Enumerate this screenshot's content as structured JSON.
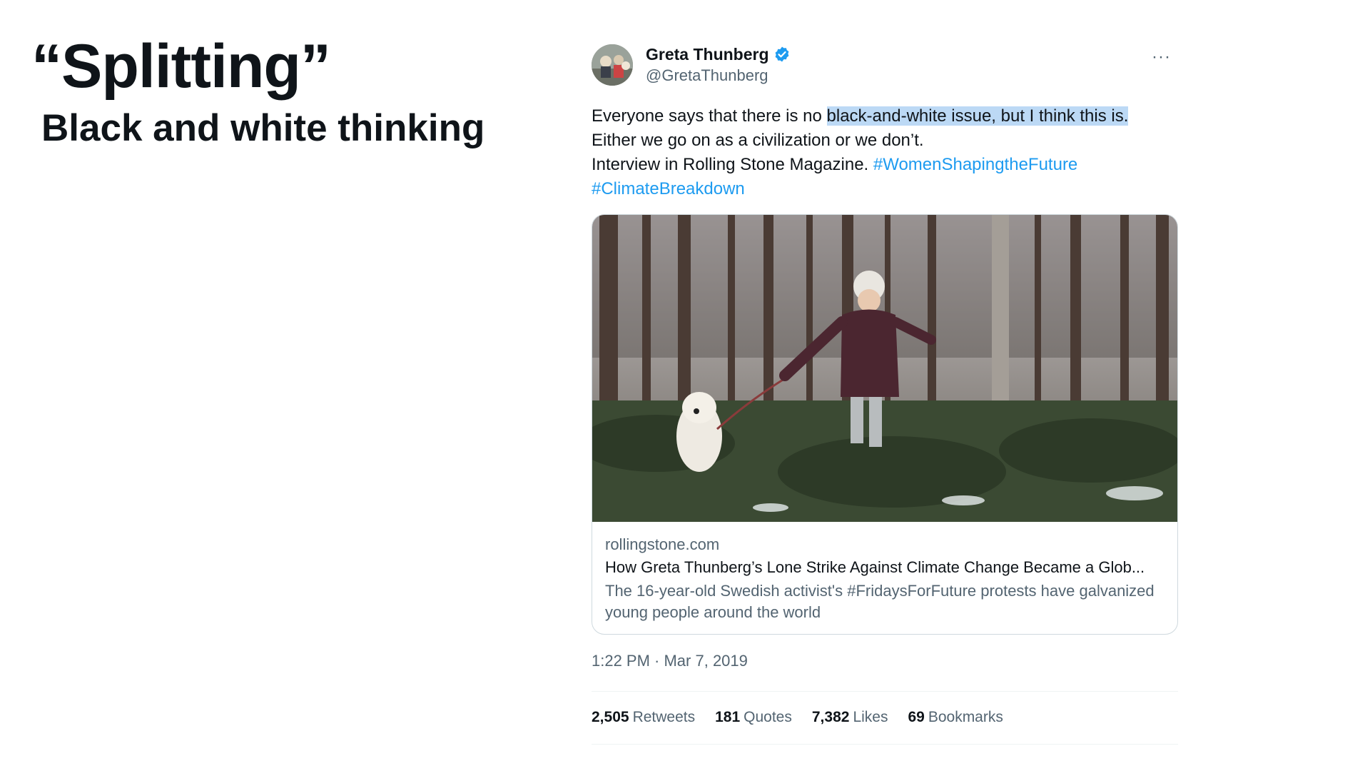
{
  "slide": {
    "title": "“Splitting”",
    "subtitle": "Black and white thinking"
  },
  "tweet": {
    "display_name": "Greta Thunberg",
    "handle": "@GretaThunberg",
    "more_label": "···",
    "text_plain_1": "Everyone says that there is no ",
    "text_highlight": "black-and-white issue, but I think this is.",
    "text_line_2": "Either we go on as a civilization or we don’t.",
    "text_line_3": "Interview in Rolling Stone Magazine. ",
    "hashtag_1": "#WomenShapingtheFuture",
    "hashtag_2": "#ClimateBreakdown",
    "card": {
      "domain": "rollingstone.com",
      "title": "How Greta Thunberg’s Lone Strike Against Climate Change Became a Glob...",
      "description": "The 16-year-old Swedish activist's #FridaysForFuture protests have galvanized young people around the world"
    },
    "timestamp": "1:22 PM · Mar 7, 2019",
    "stats": [
      {
        "count": "2,505",
        "label": "Retweets"
      },
      {
        "count": "181",
        "label": "Quotes"
      },
      {
        "count": "7,382",
        "label": "Likes"
      },
      {
        "count": "69",
        "label": "Bookmarks"
      }
    ],
    "colors": {
      "link": "#1d9bf0",
      "highlight": "#bcd9f5",
      "secondary_text": "#536471",
      "verified": "#1d9bf0"
    }
  }
}
